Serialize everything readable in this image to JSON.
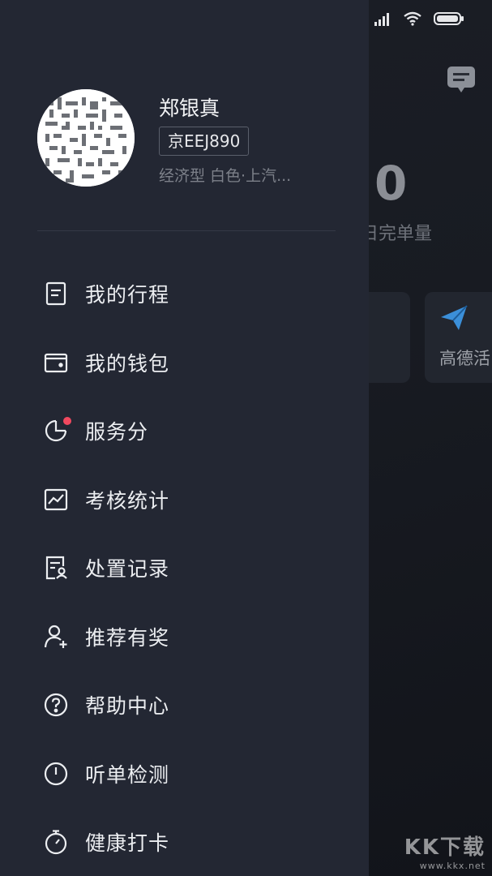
{
  "background": {
    "completed_count": "0",
    "completed_label": "日完单量",
    "card_right_label": "高德活"
  },
  "profile": {
    "name": "郑银真",
    "plate": "京EEJ890",
    "car_info": "经济型 白色·上汽..."
  },
  "menu": {
    "items": [
      {
        "label": "我的行程",
        "icon": "document-icon"
      },
      {
        "label": "我的钱包",
        "icon": "wallet-icon"
      },
      {
        "label": "服务分",
        "icon": "pie-chart-icon",
        "badge_dot": true
      },
      {
        "label": "考核统计",
        "icon": "line-chart-icon"
      },
      {
        "label": "处置记录",
        "icon": "record-user-icon"
      },
      {
        "label": "推荐有奖",
        "icon": "add-user-icon"
      },
      {
        "label": "帮助中心",
        "icon": "help-icon"
      },
      {
        "label": "听单检测",
        "icon": "clock-icon"
      },
      {
        "label": "健康打卡",
        "icon": "stopwatch-icon"
      }
    ]
  },
  "watermark": {
    "big": "KK下载",
    "small": "www.kkx.net"
  },
  "colors": {
    "drawer_bg": "#232733",
    "badge_red": "#f2495f",
    "accent_blue": "#3b8fd9"
  }
}
